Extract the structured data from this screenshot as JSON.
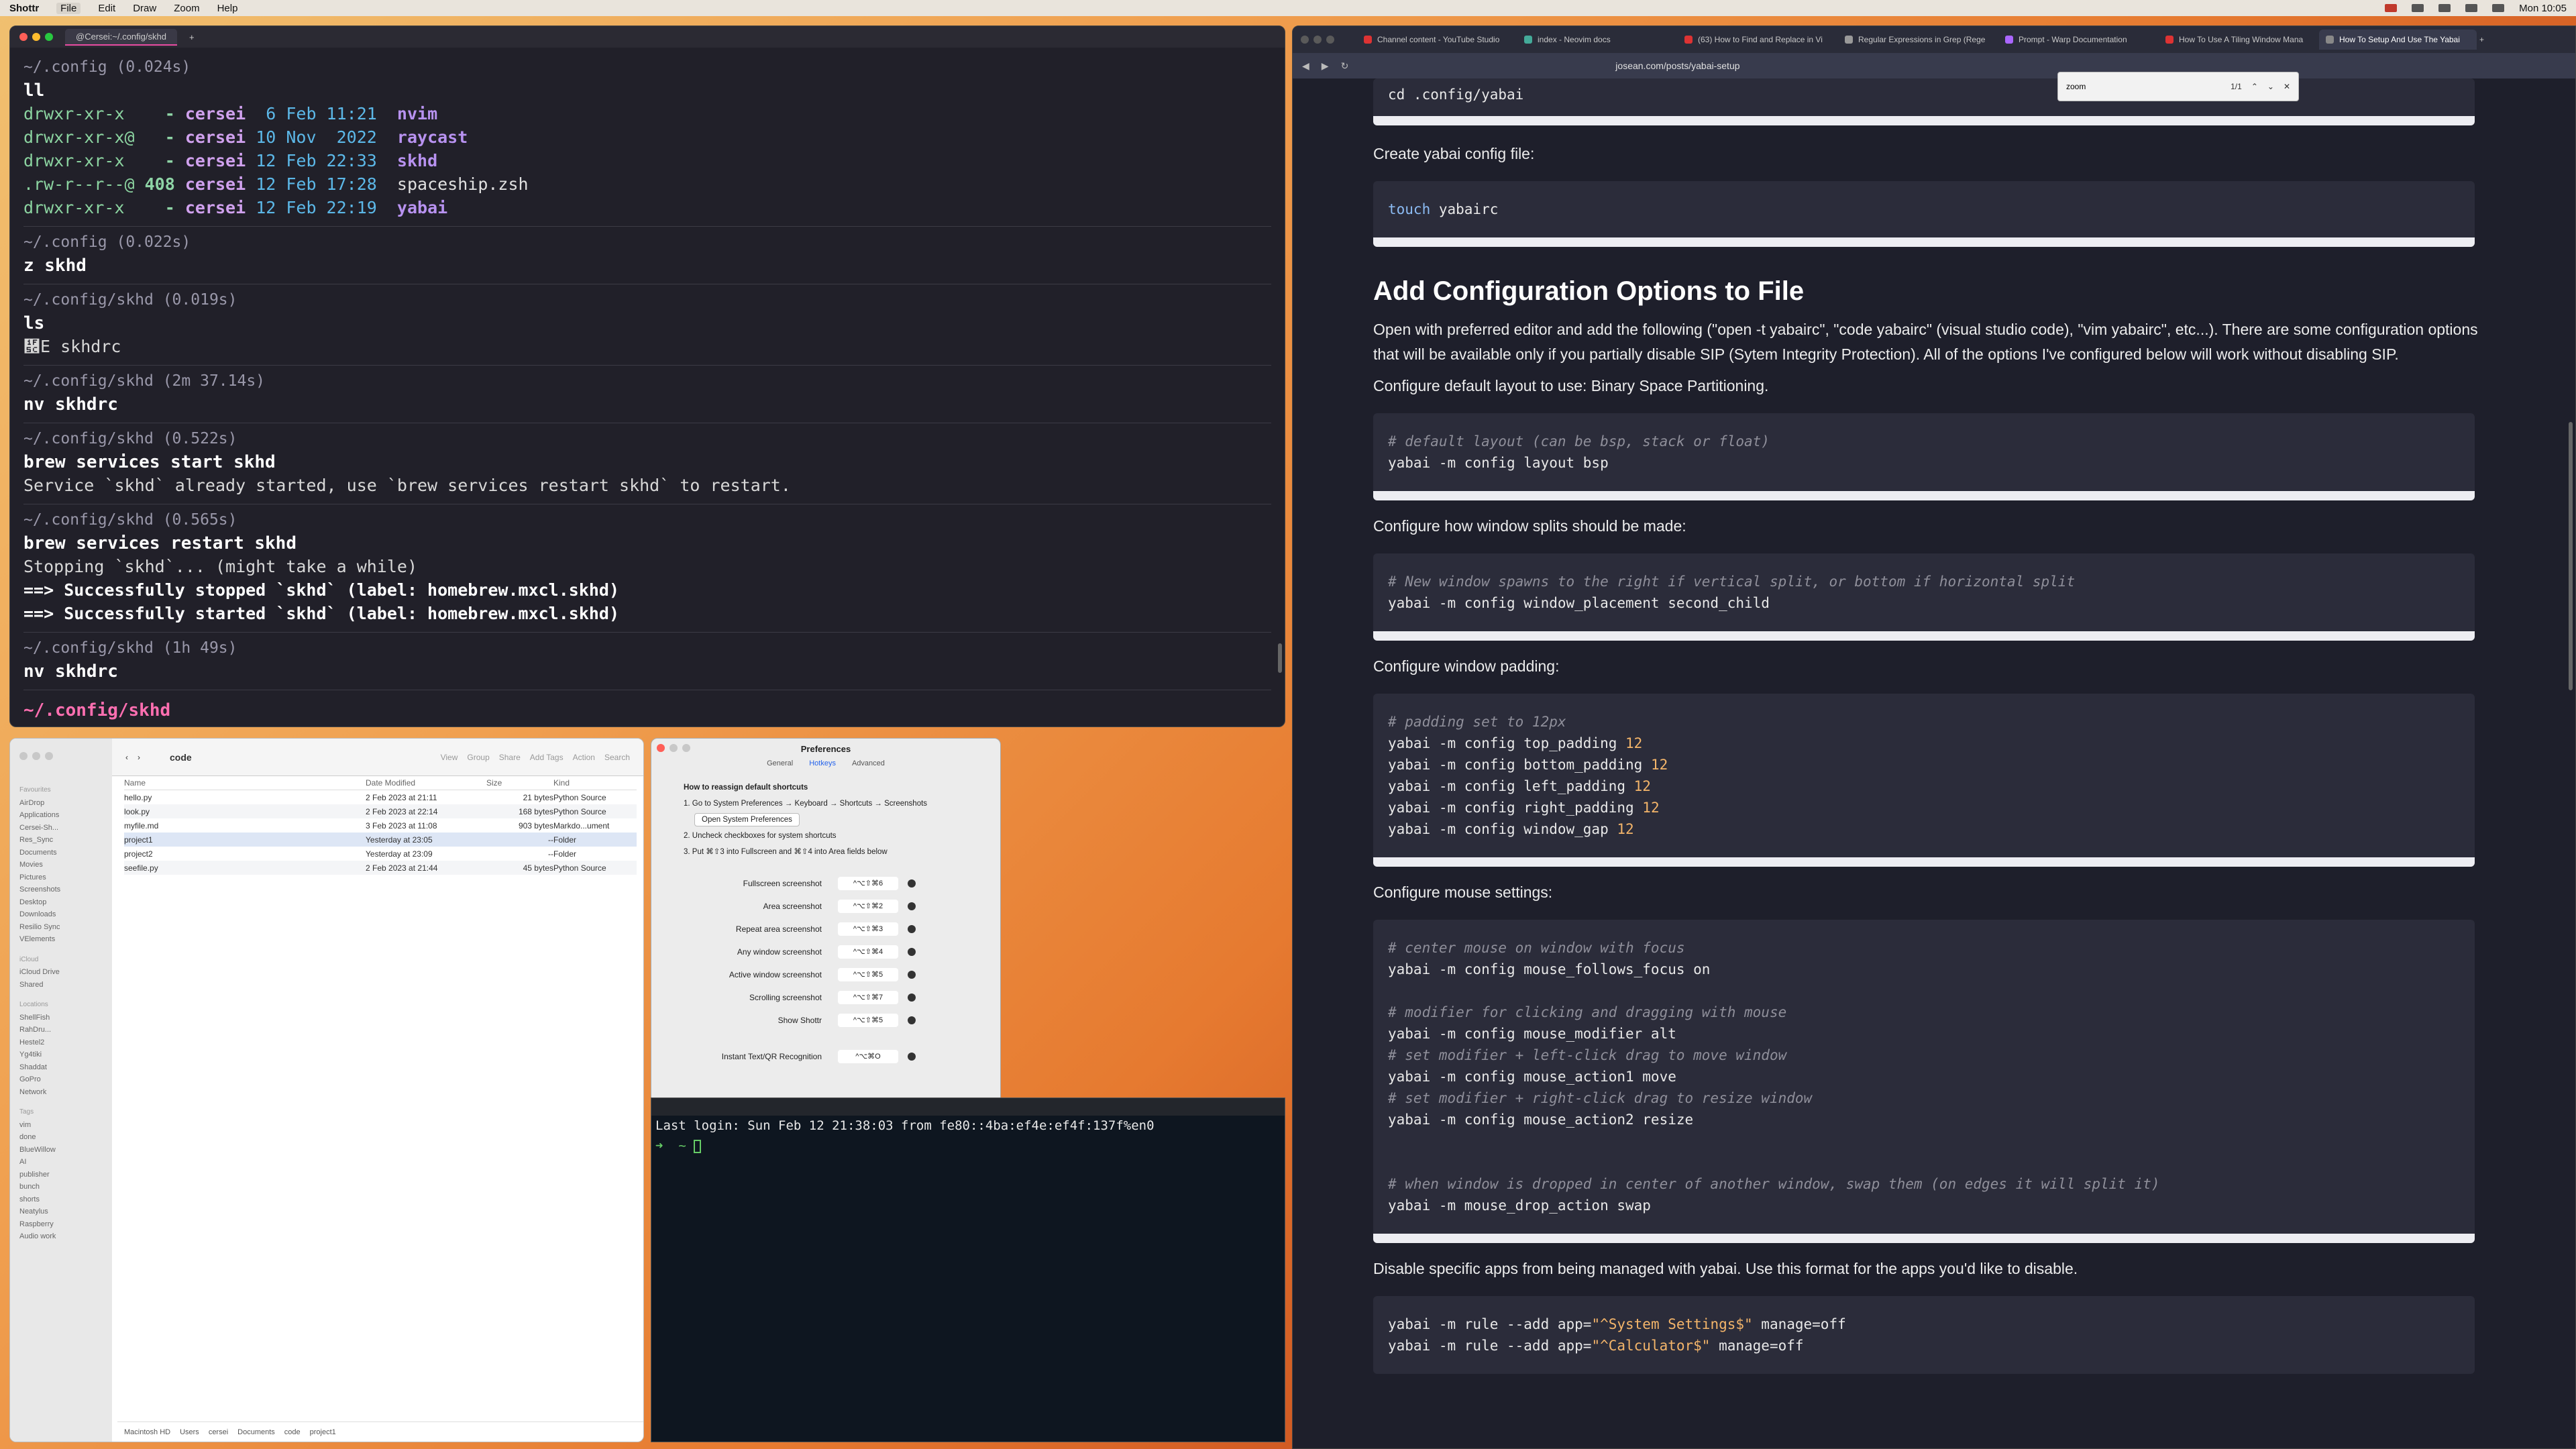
{
  "menubar": {
    "app": "Shottr",
    "items": [
      "File",
      "Edit",
      "Draw",
      "Zoom",
      "Help"
    ],
    "clock": "Mon 10:05"
  },
  "term1": {
    "tab_title": "@Cersei:~/.config/skhd",
    "blocks": [
      {
        "prompt": "~/.config (0.024s)",
        "cmd": "ll"
      },
      {
        "prompt": "~/.config (0.022s)",
        "cmd": "z skhd"
      },
      {
        "prompt": "~/.config/skhd (0.019s)",
        "cmd": "ls",
        "out": "὜E skhdrc"
      },
      {
        "prompt": "~/.config/skhd (2m 37.14s)",
        "cmd": "nv skhdrc"
      },
      {
        "prompt": "~/.config/skhd (0.522s)",
        "cmd": "brew services start skhd",
        "out": "Service `skhd` already started, use `brew services restart skhd` to restart."
      },
      {
        "prompt": "~/.config/skhd (0.565s)",
        "cmd": "brew services restart skhd",
        "out": "Stopping `skhd`... (might take a while)"
      },
      {
        "prompt": "~/.config/skhd (1h 49s)",
        "cmd": "nv skhdrc"
      }
    ],
    "ls_rows": [
      {
        "perm": "drwxr-xr-x",
        "size": "   -",
        "user": "cersei",
        "date": " 6 Feb 11:21",
        "name": "nvim",
        "dir": true
      },
      {
        "perm": "drwxr-xr-x@",
        "size": "  -",
        "user": "cersei",
        "date": "10 Nov  2022",
        "name": "raycast",
        "dir": true
      },
      {
        "perm": "drwxr-xr-x",
        "size": "   -",
        "user": "cersei",
        "date": "12 Feb 22:33",
        "name": "skhd",
        "dir": true
      },
      {
        "perm": ".rw-r--r--@",
        "size": "408",
        "user": "cersei",
        "date": "12 Feb 17:28",
        "name": "spaceship.zsh",
        "dir": false
      },
      {
        "perm": "drwxr-xr-x",
        "size": "   -",
        "user": "cersei",
        "date": "12 Feb 22:19",
        "name": "yabai",
        "dir": true
      }
    ],
    "ok1": "==> Successfully stopped `skhd` (label: homebrew.mxcl.skhd)",
    "ok2": "==> Successfully started `skhd` (label: homebrew.mxcl.skhd)",
    "cwd": "~/.config/skhd"
  },
  "browser": {
    "tabs": [
      "Channel content - YouTube Studio",
      "index - Neovim docs",
      "(63) How to Find and Replace in Vi",
      "Regular Expressions in Grep (Rege",
      "Prompt - Warp Documentation",
      "How To Use A Tiling Window Mana",
      "How To Setup And Use The Yabai"
    ],
    "url": "josean.com/posts/yabai-setup",
    "find_value": "zoom",
    "find_count": "1/1",
    "code_cd": "cd .config/yabai",
    "p_create": "Create yabai config file:",
    "code_touch_cmd": "touch",
    "code_touch_arg": " yabairc",
    "h2": "Add Configuration Options to File",
    "p_open": "Open with preferred editor and add the following (\"open -t yabairc\", \"code yabairc\" (visual studio code), \"vim yabairc\", etc...). There are some configuration options that will be available only if you partially disable SIP (Sytem Integrity Protection). All of the options I've configured below will work without disabling SIP.",
    "p_layout": "Configure default layout to use: Binary Space Partitioning.",
    "code_layout_c": "# default layout (can be bsp, stack or float)",
    "code_layout": "yabai -m config layout bsp",
    "p_splits": "Configure how window splits should be made:",
    "code_split_c": "# New window spawns to the right if vertical split, or bottom if horizontal split",
    "code_split": "yabai -m config window_placement second_child",
    "p_padding": "Configure window padding:",
    "code_pad_c": "# padding set to 12px",
    "code_pad": [
      "yabai -m config top_padding ",
      "yabai -m config bottom_padding ",
      "yabai -m config left_padding ",
      "yabai -m config right_padding ",
      "yabai -m config window_gap "
    ],
    "code_pad_val": "12",
    "p_mouse": "Configure mouse settings:",
    "code_m1_c": "# center mouse on window with focus",
    "code_m1": "yabai -m config mouse_follows_focus on",
    "code_m2_c": "# modifier for clicking and dragging with mouse",
    "code_m2": "yabai -m config mouse_modifier alt",
    "code_m3_c": "# set modifier + left-click drag to move window",
    "code_m3": "yabai -m config mouse_action1 move",
    "code_m4_c": "# set modifier + right-click drag to resize window",
    "code_m4": "yabai -m config mouse_action2 resize",
    "code_m5_c": "# when window is dropped in center of another window, swap them (on edges it will split it)",
    "code_m5": "yabai -m mouse_drop_action swap",
    "p_disable": "Disable specific apps from being managed with yabai. Use this format for the apps you'd like to disable.",
    "code_rule1_a": "yabai -m rule --add app=",
    "code_rule1_s": "\"^System Settings$\"",
    "code_rule1_b": " manage=off",
    "code_rule2_s": "\"^Calculator$\""
  },
  "finder": {
    "title": "code",
    "toolbar": [
      "View",
      "Group",
      "Share",
      "Add Tags",
      "Action",
      "Search"
    ],
    "side": [
      "Favourites",
      "AirDrop",
      "Applications",
      "Cersei-Sh...",
      "Res_Sync",
      "Documents",
      "Movies",
      "Pictures",
      "Screenshots",
      "Desktop",
      "Downloads",
      "Resilio Sync",
      "VElements",
      "iCloud",
      "iCloud Drive",
      "Shared",
      "Locations",
      "ShellFish",
      "RahDru...",
      "Hestel2",
      "Yg4tiki",
      "Shaddat",
      "GoPro",
      "Network",
      "Tags",
      "vim",
      "done",
      "BlueWillow",
      "AI",
      "publisher",
      "bunch",
      "shorts",
      "Neatylus",
      "Raspberry",
      "Audio work"
    ],
    "cols": [
      "Name",
      "Date Modified",
      "Size",
      "Kind"
    ],
    "rows": [
      {
        "name": "hello.py",
        "date": "2 Feb 2023 at 21:11",
        "size": "21 bytes",
        "kind": "Python Source"
      },
      {
        "name": "look.py",
        "date": "2 Feb 2023 at 22:14",
        "size": "168 bytes",
        "kind": "Python Source"
      },
      {
        "name": "myfile.md",
        "date": "3 Feb 2023 at 11:08",
        "size": "903 bytes",
        "kind": "Markdo...ument"
      },
      {
        "name": "project1",
        "date": "Yesterday at 23:05",
        "size": "--",
        "kind": "Folder"
      },
      {
        "name": "project2",
        "date": "Yesterday at 23:09",
        "size": "--",
        "kind": "Folder"
      },
      {
        "name": "seefile.py",
        "date": "2 Feb 2023 at 21:44",
        "size": "45 bytes",
        "kind": "Python Source"
      }
    ],
    "path": [
      "Macintosh HD",
      "Users",
      "cersei",
      "Documents",
      "code",
      "project1"
    ]
  },
  "prefs": {
    "title": "Preferences",
    "tabs": [
      "General",
      "Hotkeys",
      "Advanced"
    ],
    "inst_title": "How to reassign default shortcuts",
    "inst1": "1. Go to System Preferences → Keyboard → Shortcuts → Screenshots",
    "inst_btn": "Open System Preferences",
    "inst2": "2. Uncheck checkboxes for system shortcuts",
    "inst3": "3. Put ⌘⇧3 into Fullscreen and ⌘⇧4 into Area fields below",
    "shortcuts": [
      {
        "label": "Fullscreen screenshot",
        "key": "^⌥⇧⌘6"
      },
      {
        "label": "Area screenshot",
        "key": "^⌥⇧⌘2"
      },
      {
        "label": "Repeat area screenshot",
        "key": "^⌥⇧⌘3"
      },
      {
        "label": "Any window screenshot",
        "key": "^⌥⇧⌘4"
      },
      {
        "label": "Active window screenshot",
        "key": "^⌥⇧⌘5"
      },
      {
        "label": "Scrolling screenshot",
        "key": "^⌥⇧⌘7"
      },
      {
        "label": "Show Shottr",
        "key": "^⌥⇧⌘5"
      },
      {
        "label": "Instant Text/QR Recognition",
        "key": "^⌥⌘O"
      }
    ]
  },
  "term2": {
    "line1": "Last login: Sun Feb 12 21:38:03 from fe80::4ba:ef4e:ef4f:137f%en0",
    "line2": "➜  ~ "
  },
  "colors": {
    "pink": "#ff6fb1",
    "green": "#8bd3a0",
    "purple": "#b892f0",
    "blue": "#5cb8e8"
  }
}
